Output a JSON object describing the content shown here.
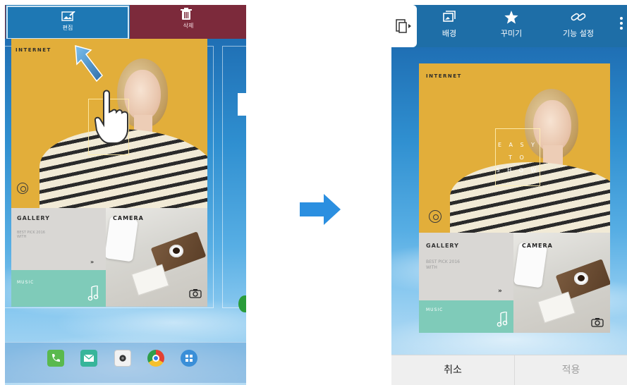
{
  "left_screen": {
    "top_bar": {
      "edit_label": "편집",
      "delete_label": "삭제"
    },
    "widget": {
      "internet_label": "INTERNET",
      "gallery_title": "GALLERY",
      "gallery_sub": "BEST PICK 2016\nWITH",
      "gallery_arrows": "»",
      "camera_title": "CAMERA",
      "music_title": "MUSIC"
    }
  },
  "right_screen": {
    "top_bar": {
      "items": [
        {
          "label": "배경",
          "icon": "wallpaper-icon"
        },
        {
          "label": "꾸미기",
          "icon": "star-icon"
        },
        {
          "label": "기능 설정",
          "icon": "link-icon"
        }
      ]
    },
    "widget": {
      "internet_label": "INTERNET",
      "overlay_words": [
        "E A S Y",
        "T O",
        "S H O W"
      ],
      "gallery_title": "GALLERY",
      "gallery_sub": "BEST PICK 2016\nWITH",
      "gallery_arrows": "»",
      "camera_title": "CAMERA",
      "music_title": "MUSIC"
    },
    "bottom_bar": {
      "cancel_label": "취소",
      "apply_label": "적용"
    }
  },
  "colors": {
    "edit_blue": "#1e78b4",
    "delete_maroon": "#7c2a3b",
    "poster_yellow": "#e2ae3a",
    "music_teal": "#7fcbb9",
    "arrow_blue": "#2b8fe0"
  }
}
